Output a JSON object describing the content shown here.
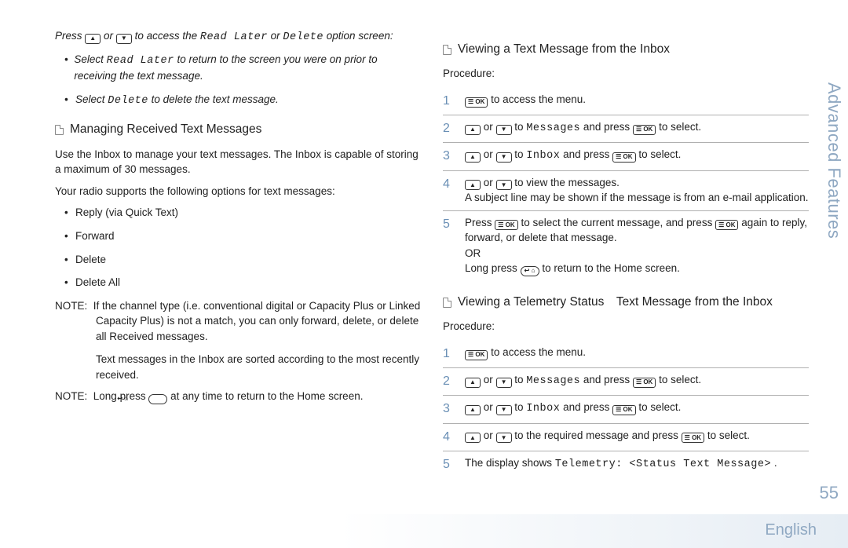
{
  "sideTab": "Advanced Features",
  "pageNumber": "55",
  "language": "English",
  "keys": {
    "up": "▲",
    "down": "▼",
    "ok": "☰ OK",
    "home": "↩ ⌂"
  },
  "left": {
    "intro_a": "Press ",
    "intro_b": " or ",
    "intro_c": " to access the ",
    "readLater": "Read Later",
    "intro_d": " or ",
    "delete": "Delete",
    "intro_e": " option screen:",
    "bullet1_a": "Select ",
    "bullet1_b": " to return to the screen you were on prior to receiving the text message.",
    "bullet2_a": "Select ",
    "bullet2_b": " to delete the text message.",
    "heading1": "Managing Received Text Messages",
    "para1": "Use the Inbox to manage your text messages. The Inbox is capable of storing a maximum of 30 messages.",
    "para2": "Your radio supports the following options for text messages:",
    "opt1": "Reply (via Quick Text)",
    "opt2": "Forward",
    "opt3": "Delete",
    "opt4": "Delete All",
    "noteLabel": "NOTE:",
    "note1a": "If the channel type (i.e. conventional digital or Capacity Plus or Linked Capacity Plus) is not a match, you can only forward, delete, or delete all Received messages.",
    "note1b": "Text messages in the Inbox are sorted according to the most recently received.",
    "note2a": "Long press ",
    "note2b": " at any time to return to the Home screen."
  },
  "right": {
    "heading1": "Viewing a Text Message from the Inbox",
    "procedure": "Procedure:",
    "s1": " to access the menu.",
    "s2a": " or ",
    "s2b": " to ",
    "messages": "Messages",
    "s2c": " and press ",
    "s2d": " to select.",
    "inbox": "Inbox",
    "s4": " to view the messages.",
    "s4note": "A subject line may be shown if the message is from an e-mail application.",
    "s5a": "Press ",
    "s5b": " to select the current message, and press ",
    "s5c": " again to reply, forward, or delete that message.",
    "or": "OR",
    "s5d": "Long press ",
    "s5e": " to return to the Home screen.",
    "heading2": "Viewing a Telemetry Status Text Message from the Inbox",
    "t4a": " to the required message and press ",
    "t4b": " to select.",
    "t5a": "The display shows ",
    "telemetry": "Telemetry: <Status Text Message>",
    "t5b": "."
  }
}
